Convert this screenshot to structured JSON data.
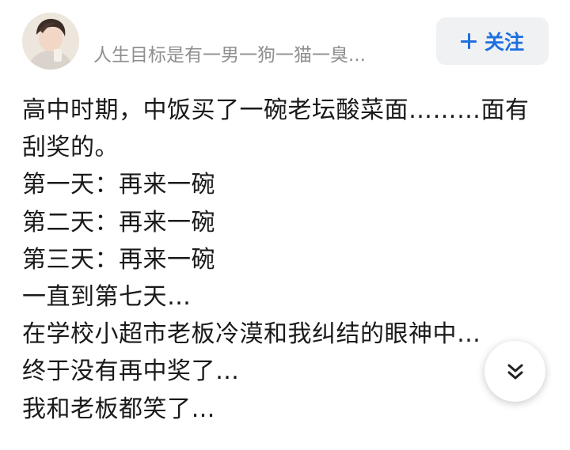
{
  "author": {
    "name": "人生目标是有一男一狗一猫一臭..."
  },
  "follow_button": {
    "icon": "plus-icon",
    "label": "关注",
    "color": "#1e6fe0"
  },
  "post": {
    "lines": [
      "高中时期，中饭买了一碗老坛酸菜面………面有",
      "刮奖的。",
      "第一天：再来一碗",
      "第二天：再来一碗",
      "第三天：再来一碗",
      "一直到第七天…",
      "在学校小超市老板冷漠和我纠结的眼神中…",
      "终于没有再中奖了…",
      "我和老板都笑了…"
    ]
  },
  "scroll_button": {
    "icon": "double-chevron-down-icon"
  }
}
